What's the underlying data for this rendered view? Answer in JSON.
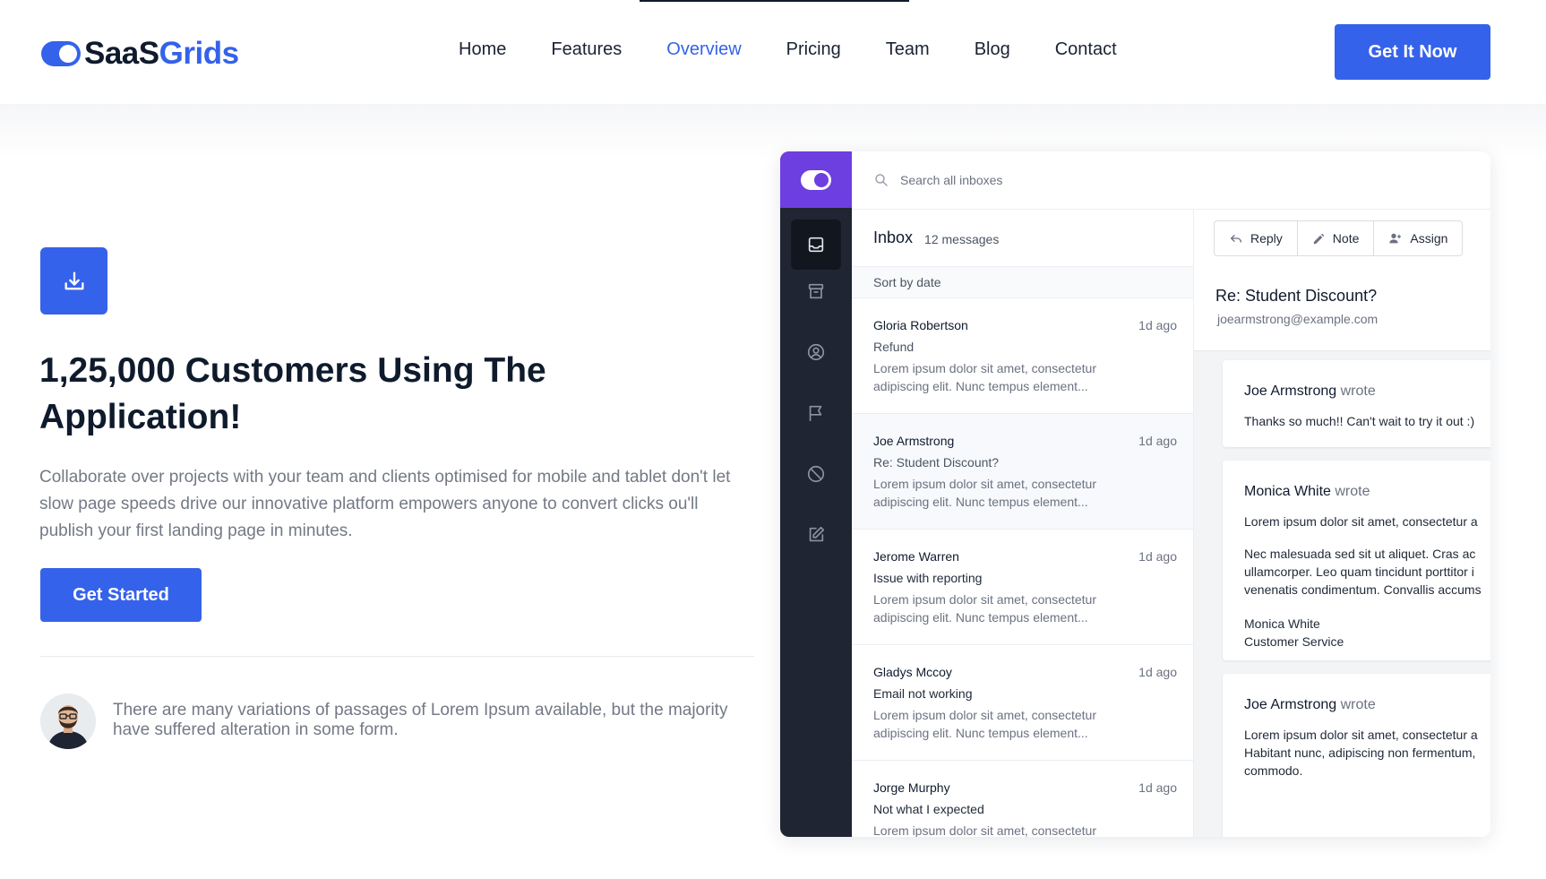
{
  "header": {
    "logo_part1": "SaaS",
    "logo_part2": "Grids",
    "nav": [
      {
        "label": "Home"
      },
      {
        "label": "Features"
      },
      {
        "label": "Overview",
        "active": true
      },
      {
        "label": "Pricing"
      },
      {
        "label": "Team"
      },
      {
        "label": "Blog"
      },
      {
        "label": "Contact"
      }
    ],
    "cta_label": "Get It Now"
  },
  "hero": {
    "headline": "1,25,000 Customers Using The Application!",
    "lead": "Collaborate over projects with your team and clients optimised for mobile and tablet don't let slow page speeds drive our innovative platform empowers anyone to convert clicks ou'll publish your first landing page in minutes.",
    "cta_label": "Get Started",
    "quote": "There are many variations of passages of Lorem Ipsum available, but the majority have suffered alteration in some form."
  },
  "app": {
    "search_placeholder": "Search all inboxes",
    "inbox_title": "Inbox",
    "inbox_count": "12 messages",
    "sort_label": "Sort by date",
    "messages": [
      {
        "from": "Gloria Robertson",
        "time": "1d ago",
        "subject": "Refund",
        "preview": "Lorem ipsum dolor sit amet, consectetur adipiscing elit. Nunc tempus element..."
      },
      {
        "from": "Joe Armstrong",
        "time": "1d ago",
        "subject": "Re: Student Discount?",
        "preview": "Lorem ipsum dolor sit amet, consectetur adipiscing elit. Nunc tempus element..."
      },
      {
        "from": "Jerome Warren",
        "time": "1d ago",
        "subject": "Issue with reporting",
        "preview": "Lorem ipsum dolor sit amet, consectetur adipiscing elit. Nunc tempus element..."
      },
      {
        "from": "Gladys Mccoy",
        "time": "1d ago",
        "subject": "Email not working",
        "preview": "Lorem ipsum dolor sit amet, consectetur adipiscing elit. Nunc tempus element..."
      },
      {
        "from": "Jorge Murphy",
        "time": "1d ago",
        "subject": "Not what I expected",
        "preview": "Lorem ipsum dolor sit amet, consectetur"
      }
    ],
    "actions": {
      "reply": "Reply",
      "note": "Note",
      "assign": "Assign"
    },
    "detail_subject": "Re: Student Discount?",
    "detail_email": "joearmstrong@example.com",
    "wrote_word": "wrote",
    "thread": [
      {
        "author": "Joe Armstrong",
        "body1": "Thanks so much!! Can't wait to try it out :)"
      },
      {
        "author": "Monica White",
        "body1": "Lorem ipsum dolor sit amet, consectetur a",
        "body2a": "Nec malesuada sed sit ut aliquet. Cras ac",
        "body2b": "ullamcorper. Leo quam tincidunt porttitor i",
        "body2c": "venenatis condimentum. Convallis accums",
        "sig_name": "Monica White",
        "sig_role": "Customer Service"
      },
      {
        "author": "Joe Armstrong",
        "body1": "Lorem ipsum dolor sit amet, consectetur a",
        "body1b": "Habitant nunc, adipiscing non fermentum,",
        "body1c": "commodo."
      }
    ]
  },
  "icons": {
    "download": "download-icon",
    "inbox": "inbox-icon",
    "archive": "archive-icon",
    "user": "user-circle-icon",
    "flag": "flag-icon",
    "ban": "ban-icon",
    "edit": "edit-icon",
    "search": "search-icon",
    "reply": "reply-icon",
    "note": "pencil-icon",
    "assign": "user-plus-icon"
  },
  "colors": {
    "accent": "#3562ea",
    "brand_purple": "#6d3fe0",
    "rail": "#1f2532",
    "heading": "#0f1b2d",
    "muted": "#737985"
  }
}
